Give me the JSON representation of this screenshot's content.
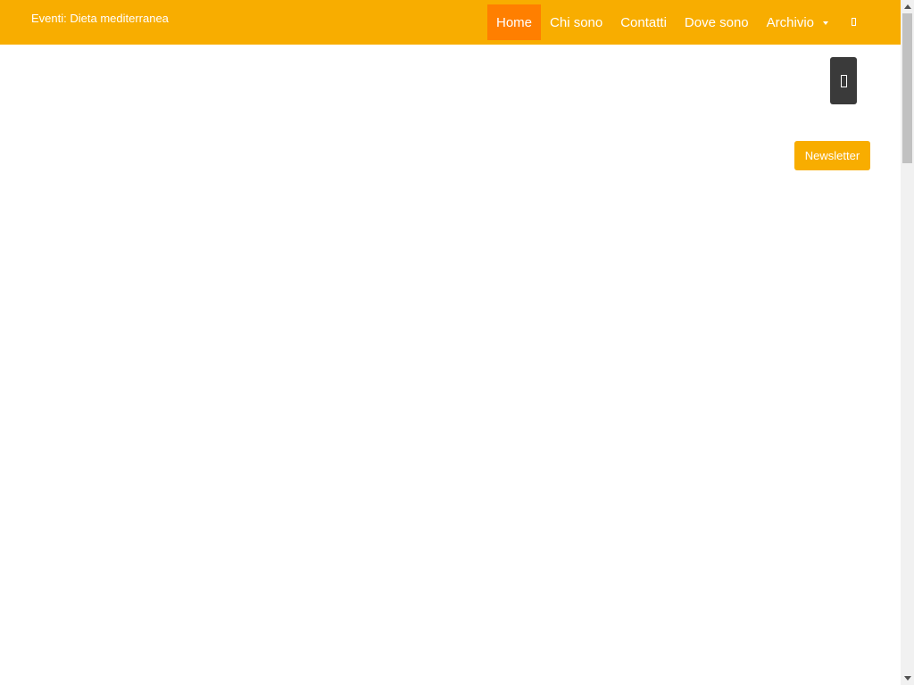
{
  "header": {
    "site_title": "Eventi: Dieta mediterranea",
    "background_color": "#f8ad00",
    "active_color": "#ff7f00"
  },
  "nav": {
    "items": [
      {
        "label": "Home",
        "active": true
      },
      {
        "label": "Chi sono",
        "active": false
      },
      {
        "label": "Contatti",
        "active": false
      },
      {
        "label": "Dove sono",
        "active": false
      },
      {
        "label": "Archivio",
        "active": false,
        "dropdown": true
      }
    ],
    "search_icon": "search-icon"
  },
  "widgets": {
    "dark_button_icon": "toggle-icon",
    "newsletter_label": "Newsletter"
  }
}
